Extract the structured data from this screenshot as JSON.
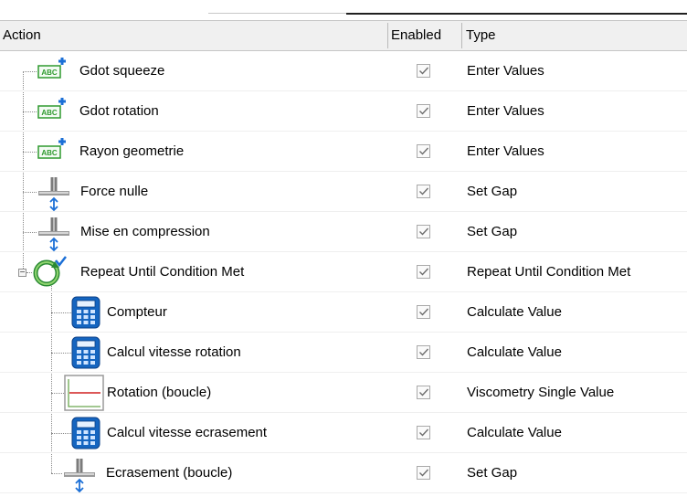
{
  "columns": {
    "action": "Action",
    "enabled": "Enabled",
    "type": "Type"
  },
  "rows": [
    {
      "label": "Gdot squeeze",
      "type": "Enter Values",
      "icon": "abc-add-icon",
      "enabled": true
    },
    {
      "label": "Gdot rotation",
      "type": "Enter Values",
      "icon": "abc-add-icon",
      "enabled": true
    },
    {
      "label": "Rayon geometrie",
      "type": "Enter Values",
      "icon": "abc-add-icon",
      "enabled": true
    },
    {
      "label": "Force nulle",
      "type": "Set Gap",
      "icon": "gap-icon",
      "enabled": true
    },
    {
      "label": "Mise en compression",
      "type": "Set Gap",
      "icon": "gap-icon",
      "enabled": true
    },
    {
      "label": "Repeat Until Condition Met",
      "type": "Repeat Until Condition Met",
      "icon": "repeat-loop-icon",
      "enabled": true,
      "expanded": true
    },
    {
      "label": "Compteur",
      "type": "Calculate Value",
      "icon": "calculator-icon",
      "enabled": true
    },
    {
      "label": "Calcul vitesse rotation",
      "type": "Calculate Value",
      "icon": "calculator-icon",
      "enabled": true
    },
    {
      "label": "Rotation (boucle)",
      "type": "Viscometry Single Value",
      "icon": "viscometry-chart-icon",
      "enabled": true
    },
    {
      "label": "Calcul vitesse ecrasement",
      "type": "Calculate Value",
      "icon": "calculator-icon",
      "enabled": true
    },
    {
      "label": "Ecrasement (boucle)",
      "type": "Set Gap",
      "icon": "gap-icon",
      "enabled": true
    }
  ],
  "colors": {
    "header_bg": "#f0f0f0",
    "abc_green": "#2e9a2e",
    "plus_blue": "#1b6fd6",
    "calc_blue": "#1565c0"
  }
}
